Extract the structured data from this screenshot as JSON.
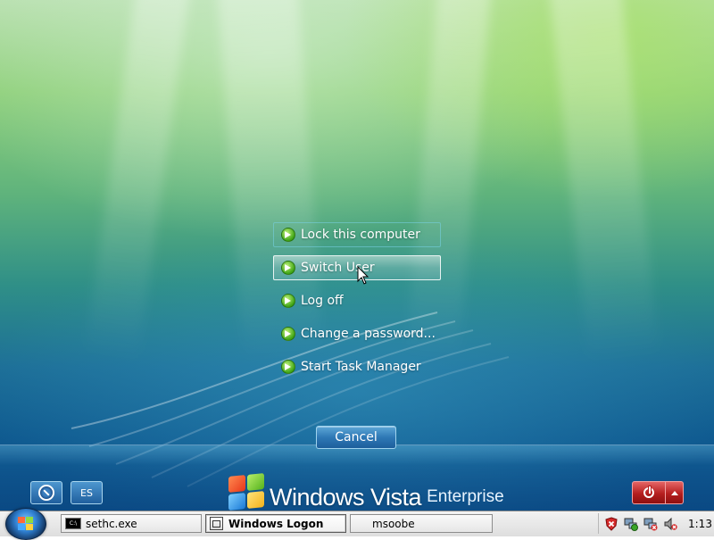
{
  "security_menu": {
    "items": [
      {
        "label": "Lock this computer",
        "state": "focus"
      },
      {
        "label": "Switch User",
        "state": "hover"
      },
      {
        "label": "Log off",
        "state": "normal"
      },
      {
        "label": "Change a password...",
        "state": "normal"
      },
      {
        "label": "Start Task Manager",
        "state": "normal"
      }
    ],
    "cancel_label": "Cancel"
  },
  "bottom_bar": {
    "ease_of_access_icon": "ease-of-access-icon",
    "language_label": "ES",
    "brand": {
      "main": "Windows Vista",
      "edition": "Enterprise"
    },
    "power_icon": "power-icon",
    "power_menu_icon": "chevron-up-icon"
  },
  "taskbar": {
    "start_icon": "windows-orb-icon",
    "tasks": [
      {
        "label": "sethc.exe",
        "icon": "console-icon",
        "active": false
      },
      {
        "label": "Windows Logon",
        "icon": "window-icon",
        "active": true
      },
      {
        "label": "msoobe",
        "icon": "",
        "active": false
      }
    ],
    "tray_icons": [
      "security-alert-icon",
      "network-icon",
      "network-disconnected-icon",
      "volume-muted-icon"
    ],
    "clock": "1:13"
  },
  "colors": {
    "accent_green": "#3ea415",
    "power_red": "#b51f1f",
    "button_blue": "#2e78b5"
  }
}
